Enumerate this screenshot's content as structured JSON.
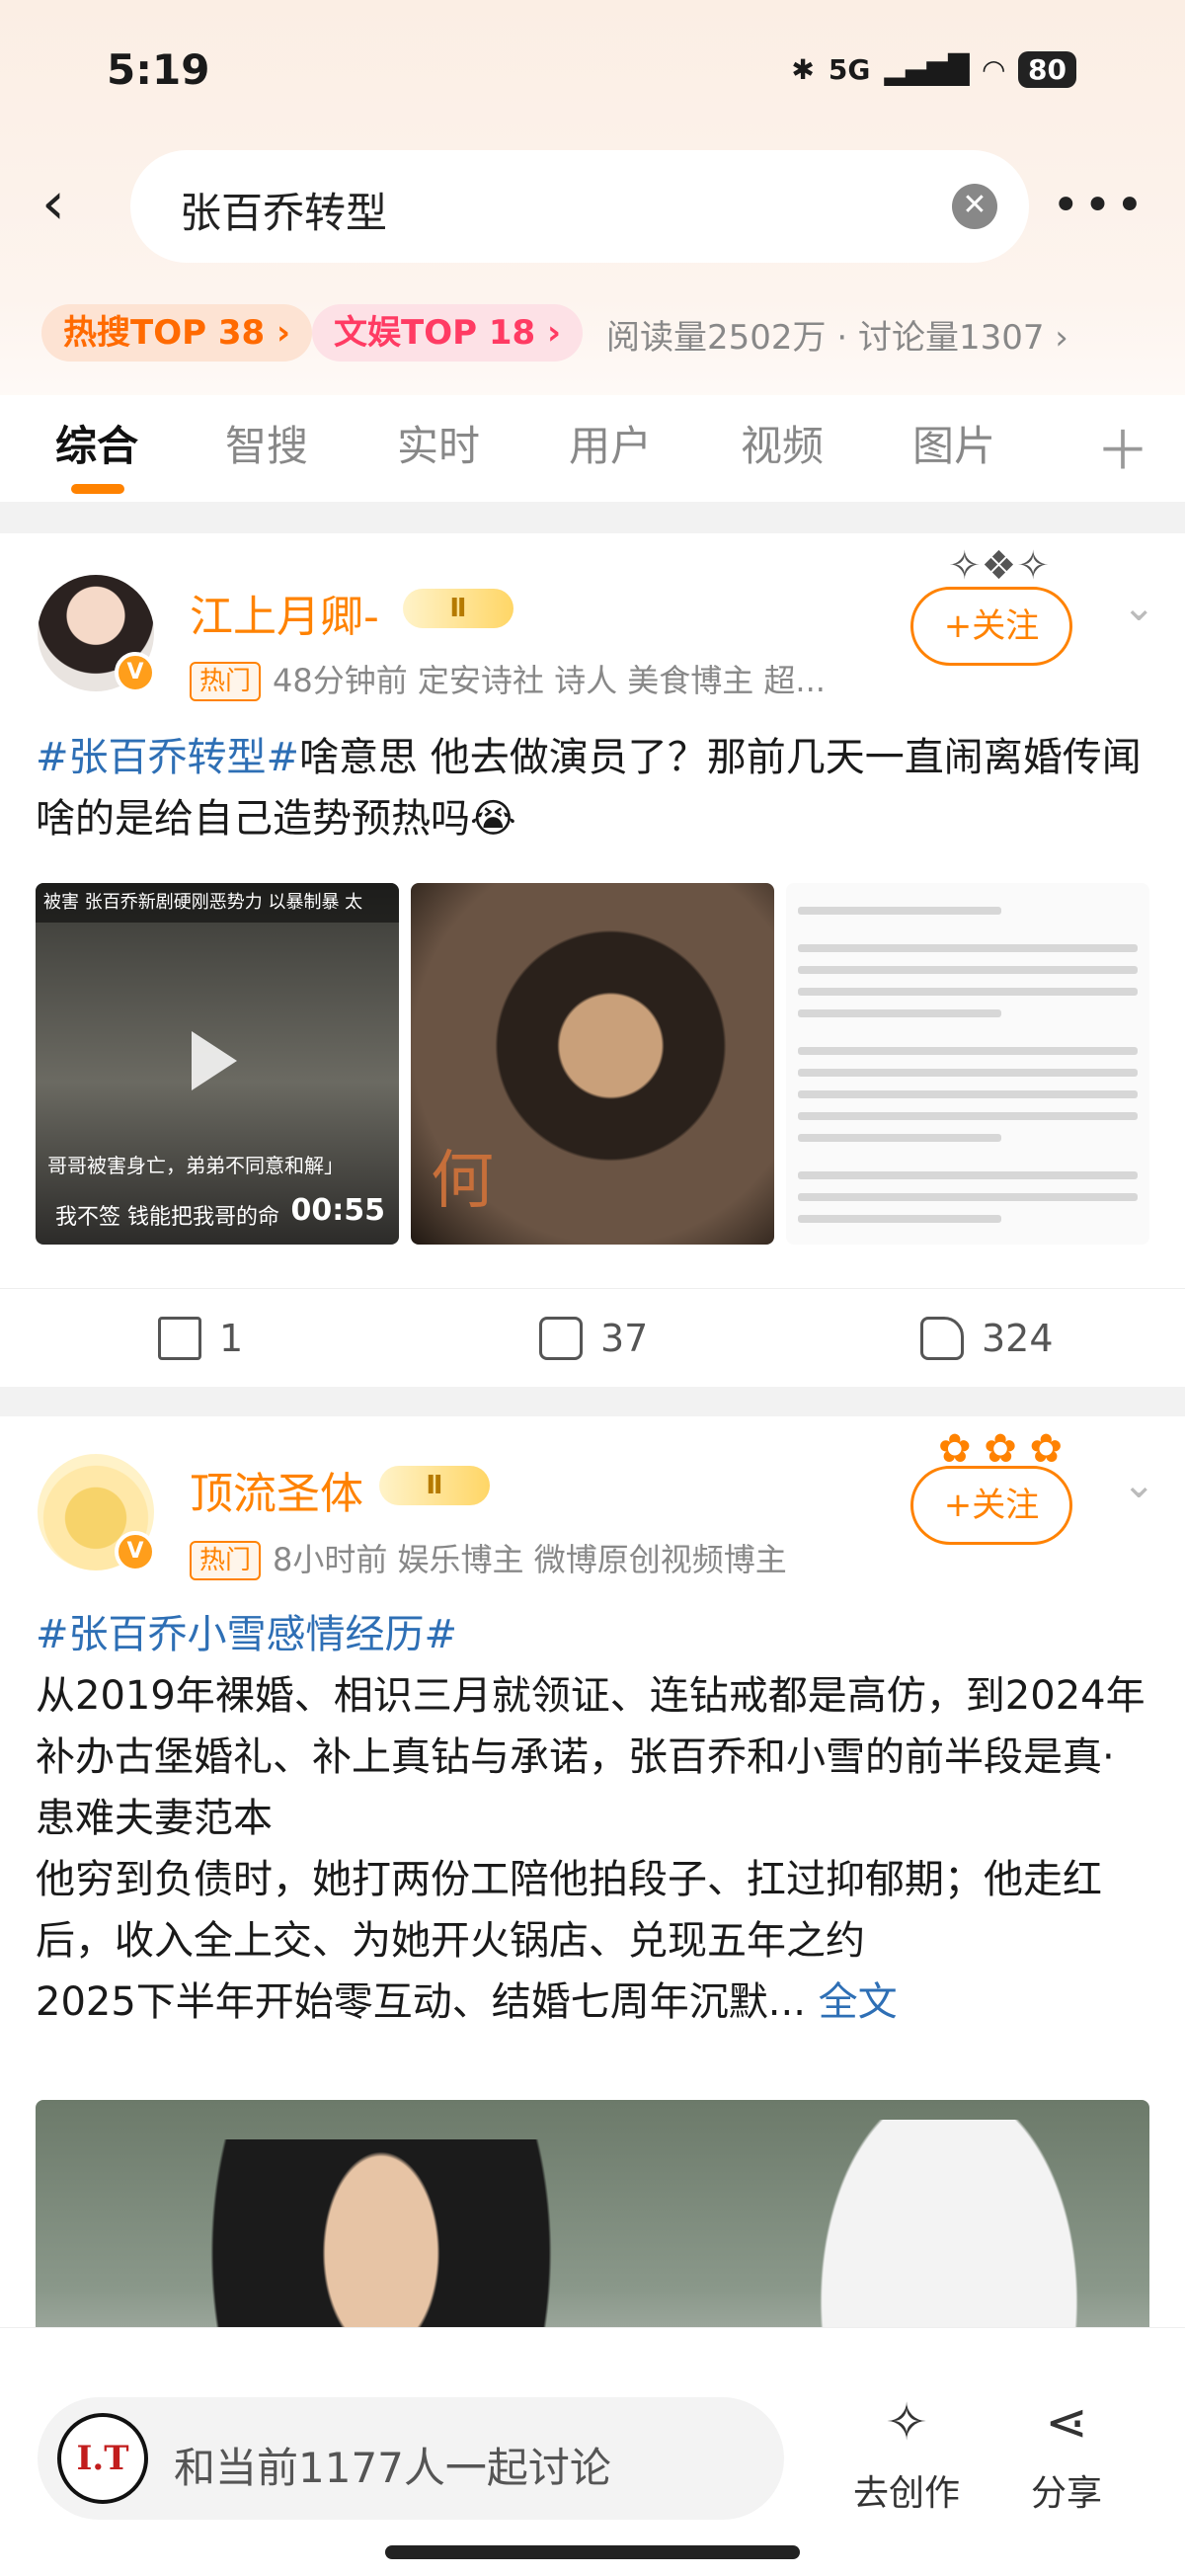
{
  "status_bar": {
    "time": "5:19",
    "network": "5G",
    "battery": "80"
  },
  "search": {
    "query": "张百乔转型",
    "clear_icon": "close-circle-icon",
    "more_icon": "more-dots-icon"
  },
  "topic_tags": {
    "hot_search": "热搜TOP 38 ›",
    "entertainment": "文娱TOP 18 ›",
    "stats": "阅读量2502万 · 讨论量1307 ›"
  },
  "tabs": [
    {
      "label": "综合",
      "active": true
    },
    {
      "label": "智搜"
    },
    {
      "label": "实时"
    },
    {
      "label": "用户"
    },
    {
      "label": "视频"
    },
    {
      "label": "图片"
    }
  ],
  "posts": [
    {
      "username": "江上月卿-",
      "level": "Ⅱ",
      "hot_tag": "热门",
      "meta": "48分钟前  定安诗社 诗人 美食博主 超...",
      "follow_label": "+关注",
      "hashtag": "#张百乔转型#",
      "text": "啥意思 他去做演员了？那前几天一直闹离婚传闻啥的是给自己造势预热吗😭",
      "video_caption_top": "被害  张百乔新剧硬刚恶势力  以暴制暴  太",
      "video_subtitle": "哥哥被害身亡，弟弟不同意和解」",
      "video_subtitle2": "我不签  钱能把我哥的命",
      "video_duration": "00:55",
      "poster_text": "何",
      "shares": "1",
      "comments": "37",
      "likes": "324"
    },
    {
      "username": "顶流圣体",
      "level": "Ⅱ",
      "hot_tag": "热门",
      "meta": "8小时前  娱乐博主 微博原创视频博主",
      "follow_label": "+关注",
      "hashtag": "#张百乔小雪感情经历#",
      "paragraph1": "从2019年裸婚、相识三月就领证、连钻戒都是高仿，到2024年补办古堡婚礼、补上真钻与承诺，张百乔和小雪的前半段是真·患难夫妻范本",
      "paragraph2": "他穷到负债时，她打两份工陪他拍段子、扛过抑郁期；他走红后，收入全上交、为她开火锅店、兑现五年之约",
      "paragraph3": "2025下半年开始零互动、结婚七周年沉默...",
      "full_text_link": "全文"
    }
  ],
  "bottom_bar": {
    "discuss_placeholder": "和当前1177人一起讨论",
    "discuss_logo": "I.T",
    "create_label": "去创作",
    "share_label": "分享"
  }
}
